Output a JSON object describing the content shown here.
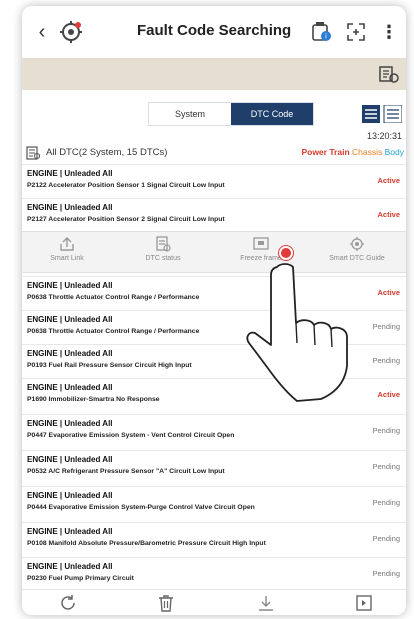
{
  "header": {
    "title": "Fault Code Searching",
    "back_icon": "chevron-left-icon",
    "settings_icon": "gear-icon",
    "more_icon": "kebab-icon"
  },
  "tabs": [
    {
      "label": "System",
      "selected": false
    },
    {
      "label": "DTC Code",
      "selected": true
    }
  ],
  "summary": {
    "time": "13:20:31",
    "text": "All DTC(2 System, 15 DTCs)",
    "categories": [
      "Power Train",
      "Chassis",
      "Body"
    ]
  },
  "dtcs": [
    {
      "ecu": "ENGINE | Unleaded All",
      "desc": "P2122 Accelerator Position Sensor 1 Signal Circuit Low Input",
      "status": "Active"
    },
    {
      "ecu": "ENGINE | Unleaded All",
      "desc": "P2127 Accelerator Position Sensor 2 Signal Circuit Low Input",
      "status": "Active"
    },
    {
      "ecu": "ENGINE | Unleaded All",
      "desc": "P0638 Throttle Actuator Control Range / Performance",
      "status": "Active"
    },
    {
      "ecu": "ENGINE | Unleaded All",
      "desc": "P0638 Throttle Actuator Control Range / Performance",
      "status": "Pending"
    },
    {
      "ecu": "ENGINE | Unleaded All",
      "desc": "P0193 Fuel Rail Pressure Sensor Circuit High Input",
      "status": "Pending"
    },
    {
      "ecu": "ENGINE | Unleaded All",
      "desc": "P1690 Immobilizer-Smartra No Response",
      "status": "Active"
    },
    {
      "ecu": "ENGINE | Unleaded All",
      "desc": "P0447 Evaporative Emission System - Vent Control Circuit Open",
      "status": "Pending"
    },
    {
      "ecu": "ENGINE | Unleaded All",
      "desc": "P0532 A/C Refrigerant Pressure Sensor \"A\" Circuit Low Input",
      "status": "Pending"
    },
    {
      "ecu": "ENGINE | Unleaded All",
      "desc": "P0444 Evaporative Emission System-Purge Control Valve Circuit Open",
      "status": "Pending"
    },
    {
      "ecu": "ENGINE | Unleaded All",
      "desc": "P0108 Manifold Absolute Pressure/Barometric Pressure Circuit High Input",
      "status": "Pending"
    },
    {
      "ecu": "ENGINE | Unleaded All",
      "desc": "P0230 Fuel Pump Primary Circuit",
      "status": "Pending"
    }
  ],
  "actions": [
    {
      "label": "Smart Link",
      "icon": "share-icon"
    },
    {
      "label": "DTC status",
      "icon": "dtc-status-icon"
    },
    {
      "label": "Freeze frame",
      "icon": "freeze-frame-icon"
    },
    {
      "label": "Smart DTC Guide",
      "icon": "dtc-guide-icon"
    }
  ],
  "bottom_icons": [
    "refresh-icon",
    "delete-icon",
    "download-icon",
    "export-icon"
  ],
  "colors": {
    "accent": "#1f3e6a",
    "active": "#d43a2c",
    "chassis": "#e67e22",
    "body": "#25a3d6",
    "sand": "#e6ded1"
  }
}
